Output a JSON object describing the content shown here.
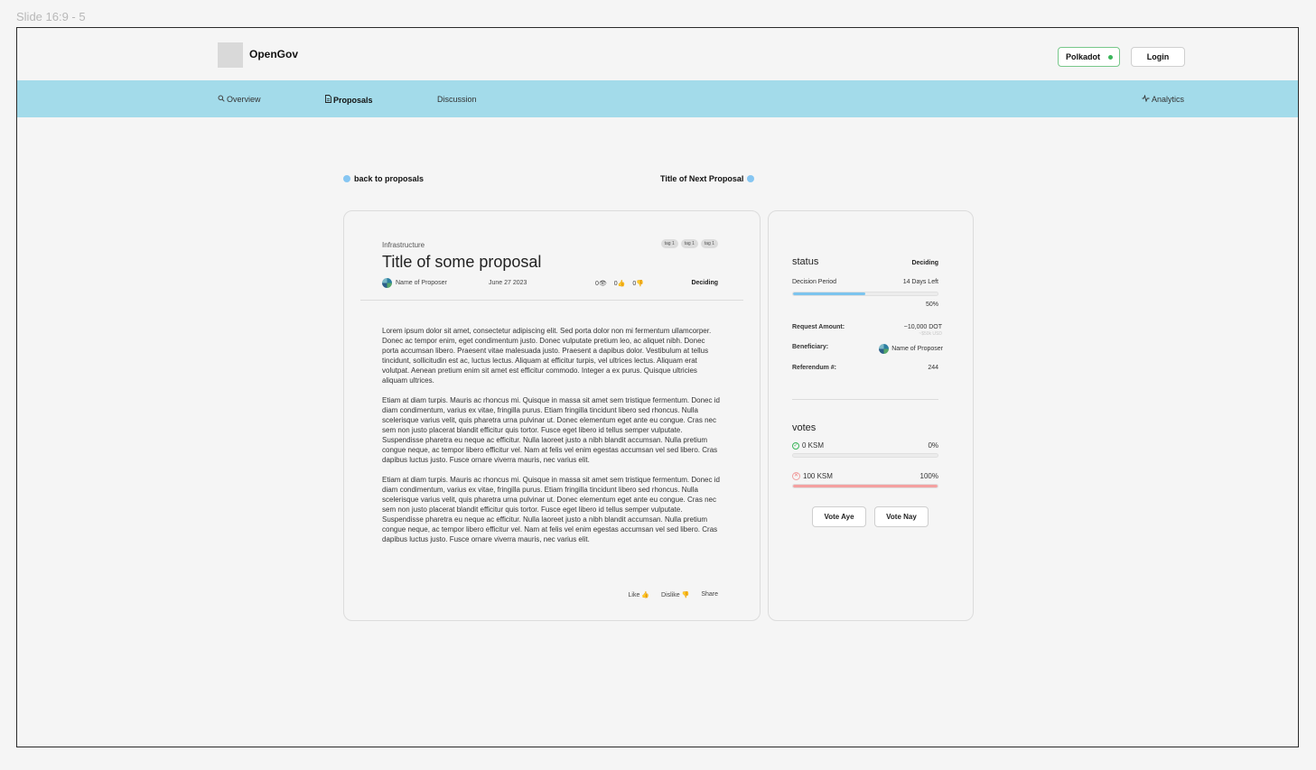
{
  "slide_label": "Slide 16:9 - 5",
  "app": {
    "title": "OpenGov"
  },
  "header": {
    "network_label": "Polkadot",
    "login_label": "Login"
  },
  "nav": {
    "overview": "Overview",
    "proposals": "Proposals",
    "discussion": "Discussion",
    "analytics": "Analytics"
  },
  "links": {
    "back": "back to proposals",
    "next": "Title of Next Proposal"
  },
  "proposal": {
    "category": "Infrastructure",
    "tags": [
      "tag 1",
      "tag 1",
      "tag 1"
    ],
    "title": "Title of some proposal",
    "proposer": "Name of Proposer",
    "date": "June 27 2023",
    "views": "0",
    "likes": "0",
    "dislikes": "0",
    "status": "Deciding",
    "paragraphs": [
      "Lorem ipsum dolor sit amet, consectetur adipiscing elit. Sed porta dolor non mi fermentum ullamcorper. Donec ac tempor enim, eget condimentum justo. Donec vulputate pretium leo, ac aliquet nibh. Donec porta accumsan libero. Praesent vitae malesuada justo. Praesent a dapibus dolor. Vestibulum at tellus tincidunt, sollicitudin est ac, luctus lectus. Aliquam at efficitur turpis, vel ultrices lectus. Aliquam erat volutpat. Aenean pretium enim sit amet est efficitur commodo. Integer a ex purus. Quisque ultricies aliquam ultrices.",
      "Etiam at diam turpis. Mauris ac rhoncus mi. Quisque in massa sit amet sem tristique fermentum. Donec id diam condimentum, varius ex vitae, fringilla purus. Etiam fringilla tincidunt libero sed rhoncus. Nulla scelerisque varius velit, quis pharetra urna pulvinar ut. Donec elementum eget ante eu congue. Cras nec sem non justo placerat blandit efficitur quis tortor. Fusce eget libero id tellus semper vulputate. Suspendisse pharetra eu neque ac efficitur. Nulla laoreet justo a nibh blandit accumsan. Nulla pretium congue neque, ac tempor libero efficitur vel. Nam at felis vel enim egestas accumsan vel sed libero. Cras dapibus luctus justo. Fusce ornare viverra mauris, nec varius elit.",
      "Etiam at diam turpis. Mauris ac rhoncus mi. Quisque in massa sit amet sem tristique fermentum. Donec id diam condimentum, varius ex vitae, fringilla purus. Etiam fringilla tincidunt libero sed rhoncus. Nulla scelerisque varius velit, quis pharetra urna pulvinar ut. Donec elementum eget ante eu congue. Cras nec sem non justo placerat blandit efficitur quis tortor. Fusce eget libero id tellus semper vulputate. Suspendisse pharetra eu neque ac efficitur. Nulla laoreet justo a nibh blandit accumsan. Nulla pretium congue neque, ac tempor libero efficitur vel. Nam at felis vel enim egestas accumsan vel sed libero. Cras dapibus luctus justo. Fusce ornare viverra mauris, nec varius elit."
    ],
    "actions": {
      "like": "Like",
      "dislike": "Dislike",
      "share": "Share"
    }
  },
  "status_panel": {
    "heading": "status",
    "status_value": "Deciding",
    "decision_period_label": "Decision Period",
    "days_left": "14 Days Left",
    "progress_percent": 50,
    "progress_label": "50%",
    "request_amount_label": "Request Amount:",
    "request_amount_value": "~10,000 DOT",
    "request_amount_usd": "~$50k USD",
    "beneficiary_label": "Beneficiary:",
    "beneficiary_value": "Name of Proposer",
    "referendum_label": "Referendum #:",
    "referendum_value": "244"
  },
  "votes_panel": {
    "heading": "votes",
    "aye_amount": "0 KSM",
    "aye_percent_label": "0%",
    "aye_percent": 0,
    "nay_amount": "100 KSM",
    "nay_percent_label": "100%",
    "nay_percent": 100,
    "vote_aye_label": "Vote Aye",
    "vote_nay_label": "Vote Nay"
  },
  "colors": {
    "nav_bg": "#a3dbea",
    "progress": "#7cc4ee",
    "nay": "#f4a0a0",
    "network_border": "#78c88a",
    "network_dot": "#3bb55a"
  }
}
